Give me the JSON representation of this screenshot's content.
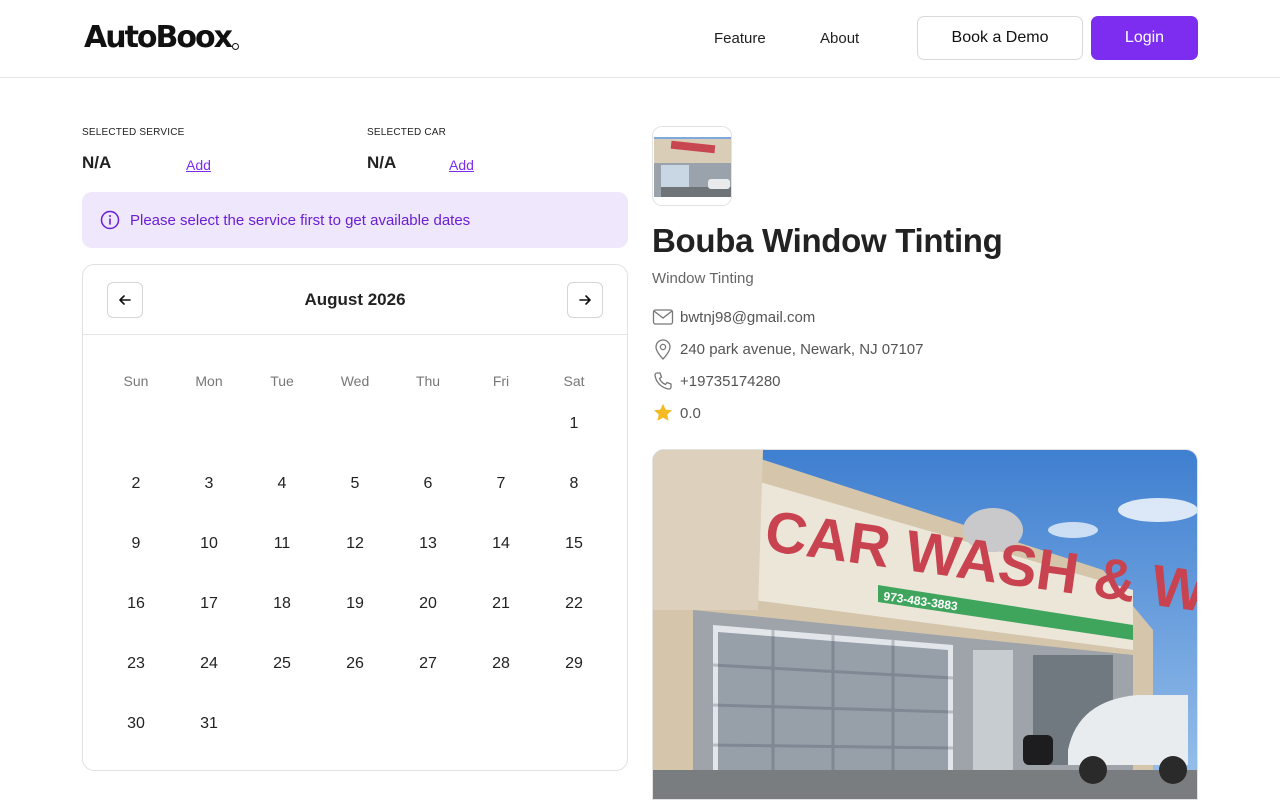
{
  "header": {
    "logo_text": "AutoBoox",
    "nav": {
      "feature": "Feature",
      "about": "About"
    },
    "book_demo_label": "Book a Demo",
    "login_label": "Login",
    "accent_color": "#7c2df0"
  },
  "selection": {
    "service_label": "SELECTED SERVICE",
    "service_value": "N/A",
    "service_add": "Add",
    "car_label": "SELECTED CAR",
    "car_value": "N/A",
    "car_add": "Add"
  },
  "banner": {
    "icon": "info-icon",
    "text": "Please select the service first to get available dates"
  },
  "calendar": {
    "month_label": "August 2026",
    "prev_icon": "arrow-left-icon",
    "next_icon": "arrow-right-icon",
    "weekdays": [
      "Sun",
      "Mon",
      "Tue",
      "Wed",
      "Thu",
      "Fri",
      "Sat"
    ],
    "first_weekday_index": 6,
    "days": [
      "1",
      "2",
      "3",
      "4",
      "5",
      "6",
      "7",
      "8",
      "9",
      "10",
      "11",
      "12",
      "13",
      "14",
      "15",
      "16",
      "17",
      "18",
      "19",
      "20",
      "21",
      "22",
      "23",
      "24",
      "25",
      "26",
      "27",
      "28",
      "29",
      "30",
      "31"
    ]
  },
  "business": {
    "name": "Bouba Window Tinting",
    "category": "Window Tinting",
    "email": "bwtnj98@gmail.com",
    "address": "240 park avenue, Newark, NJ 07107",
    "phone": "+19735174280",
    "rating": "0.0",
    "icons": [
      "mail-icon",
      "location-pin-icon",
      "phone-icon",
      "star-icon"
    ],
    "storefront_sign": "CAR WASH & WINDOW TINT",
    "storefront_phone": "973-483-3883"
  }
}
